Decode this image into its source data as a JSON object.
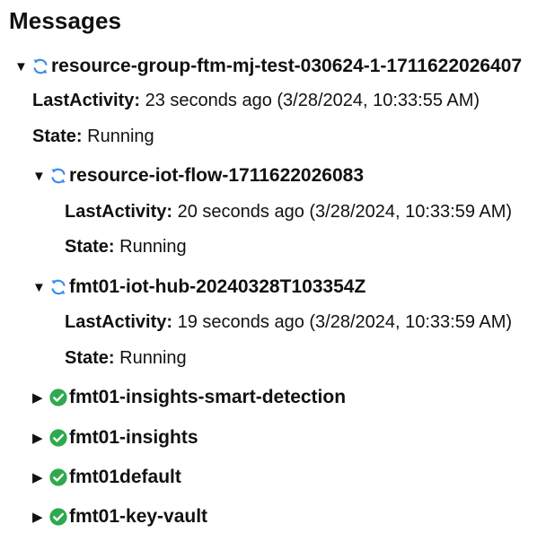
{
  "page": {
    "title": "Messages"
  },
  "tree": {
    "root": {
      "name": "resource-group-ftm-mj-test-030624-1-1711622026407",
      "status_icon": "sync-icon",
      "last_activity_label": "LastActivity:",
      "last_activity_value": "23 seconds ago (3/28/2024, 10:33:55 AM)",
      "state_label": "State:",
      "state_value": "Running",
      "children": [
        {
          "name": "resource-iot-flow-1711622026083",
          "status_icon": "sync-icon",
          "expanded": true,
          "last_activity_label": "LastActivity:",
          "last_activity_value": "20 seconds ago (3/28/2024, 10:33:59 AM)",
          "state_label": "State:",
          "state_value": "Running"
        },
        {
          "name": "fmt01-iot-hub-20240328T103354Z",
          "status_icon": "sync-icon",
          "expanded": true,
          "last_activity_label": "LastActivity:",
          "last_activity_value": "19 seconds ago (3/28/2024, 10:33:59 AM)",
          "state_label": "State:",
          "state_value": "Running"
        },
        {
          "name": "fmt01-insights-smart-detection",
          "status_icon": "success-check-icon",
          "expanded": false
        },
        {
          "name": "fmt01-insights",
          "status_icon": "success-check-icon",
          "expanded": false
        },
        {
          "name": "fmt01default",
          "status_icon": "success-check-icon",
          "expanded": false
        },
        {
          "name": "fmt01-key-vault",
          "status_icon": "success-check-icon",
          "expanded": false
        }
      ]
    }
  },
  "colors": {
    "sync_blue": "#3b8ee8",
    "success_green": "#2eaa4e"
  }
}
